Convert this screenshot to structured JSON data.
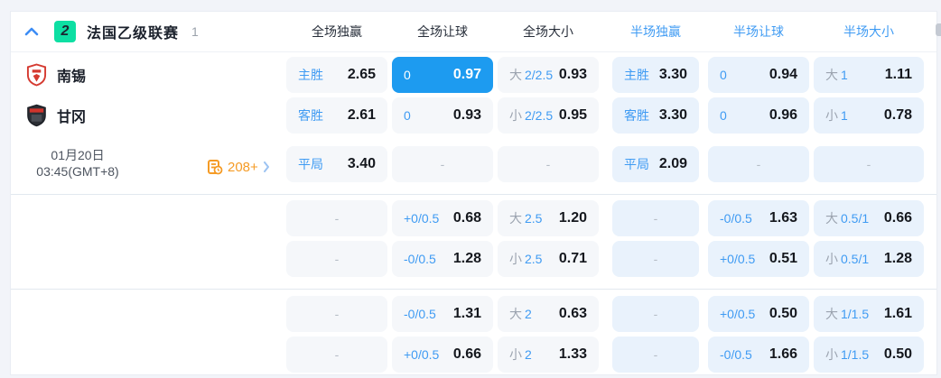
{
  "colors": {
    "accent_selected": "#1d9bf0",
    "blue_text": "#3f9bf3",
    "half_cell_bg": "#e9f2fc",
    "full_cell_bg": "#f5f7fa",
    "orange": "#f59b25",
    "badge_green": "#0ddfa3",
    "home_crest_red": "#d53a30",
    "away_crest_dark": "#2b2e34"
  },
  "header": {
    "league": {
      "badge_text": "2",
      "name": "法国乙级联赛",
      "match_count": "1"
    },
    "columns": [
      {
        "label": "全场独赢",
        "half": false
      },
      {
        "label": "全场让球",
        "half": false
      },
      {
        "label": "全场大小",
        "half": false
      },
      {
        "label": "半场独赢",
        "half": true
      },
      {
        "label": "半场让球",
        "half": true
      },
      {
        "label": "半场大小",
        "half": true
      }
    ]
  },
  "match": {
    "home_team": "南锡",
    "away_team": "甘冈",
    "date": "01月20日",
    "time": "03:45(GMT+8)",
    "markets_count": "208+"
  },
  "rows": [
    [
      {
        "type": "pick",
        "label": "主胜",
        "value": "2.65"
      },
      {
        "type": "hcp",
        "hcp": "0",
        "value": "0.97",
        "selected": true
      },
      {
        "type": "ou",
        "side": "大",
        "line": "2/2.5",
        "value": "0.93"
      },
      {
        "type": "pick",
        "label": "主胜",
        "value": "3.30"
      },
      {
        "type": "hcp",
        "hcp": "0",
        "value": "0.94"
      },
      {
        "type": "ou",
        "side": "大",
        "line": "1",
        "value": "1.11"
      }
    ],
    [
      {
        "type": "pick",
        "label": "客胜",
        "value": "2.61"
      },
      {
        "type": "hcp",
        "hcp": "0",
        "value": "0.93"
      },
      {
        "type": "ou",
        "side": "小",
        "line": "2/2.5",
        "value": "0.95"
      },
      {
        "type": "pick",
        "label": "客胜",
        "value": "3.30"
      },
      {
        "type": "hcp",
        "hcp": "0",
        "value": "0.96"
      },
      {
        "type": "ou",
        "side": "小",
        "line": "1",
        "value": "0.78"
      }
    ],
    [
      {
        "type": "pick",
        "label": "平局",
        "value": "3.40"
      },
      {
        "type": "empty"
      },
      {
        "type": "empty"
      },
      {
        "type": "pick",
        "label": "平局",
        "value": "2.09"
      },
      {
        "type": "empty"
      },
      {
        "type": "empty"
      }
    ],
    [
      {
        "type": "empty"
      },
      {
        "type": "hcp",
        "hcp": "+0/0.5",
        "value": "0.68"
      },
      {
        "type": "ou",
        "side": "大",
        "line": "2.5",
        "value": "1.20"
      },
      {
        "type": "empty"
      },
      {
        "type": "hcp",
        "hcp": "-0/0.5",
        "value": "1.63"
      },
      {
        "type": "ou",
        "side": "大",
        "line": "0.5/1",
        "value": "0.66"
      }
    ],
    [
      {
        "type": "empty"
      },
      {
        "type": "hcp",
        "hcp": "-0/0.5",
        "value": "1.28"
      },
      {
        "type": "ou",
        "side": "小",
        "line": "2.5",
        "value": "0.71"
      },
      {
        "type": "empty"
      },
      {
        "type": "hcp",
        "hcp": "+0/0.5",
        "value": "0.51"
      },
      {
        "type": "ou",
        "side": "小",
        "line": "0.5/1",
        "value": "1.28"
      }
    ],
    [
      {
        "type": "empty"
      },
      {
        "type": "hcp",
        "hcp": "-0/0.5",
        "value": "1.31"
      },
      {
        "type": "ou",
        "side": "大",
        "line": "2",
        "value": "0.63"
      },
      {
        "type": "empty"
      },
      {
        "type": "hcp",
        "hcp": "+0/0.5",
        "value": "0.50"
      },
      {
        "type": "ou",
        "side": "大",
        "line": "1/1.5",
        "value": "1.61"
      }
    ],
    [
      {
        "type": "empty"
      },
      {
        "type": "hcp",
        "hcp": "+0/0.5",
        "value": "0.66"
      },
      {
        "type": "ou",
        "side": "小",
        "line": "2",
        "value": "1.33"
      },
      {
        "type": "empty"
      },
      {
        "type": "hcp",
        "hcp": "-0/0.5",
        "value": "1.66"
      },
      {
        "type": "ou",
        "side": "小",
        "line": "1/1.5",
        "value": "0.50"
      }
    ]
  ]
}
